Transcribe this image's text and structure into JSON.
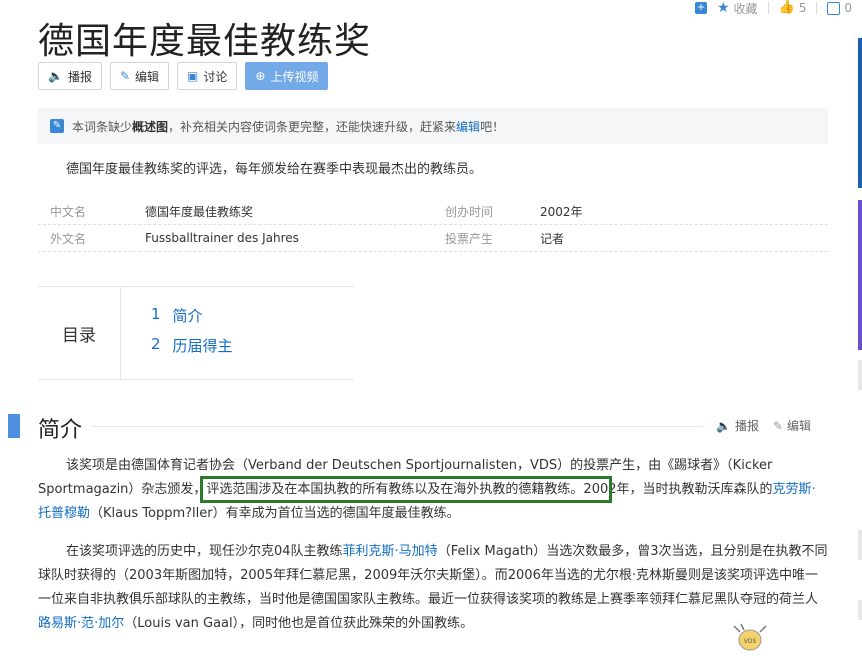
{
  "topbar": {
    "favorite": "收藏",
    "likes": "5",
    "shares": "0"
  },
  "title": "德国年度最佳教练奖",
  "buttons": {
    "read": "播报",
    "edit": "编辑",
    "discuss": "讨论",
    "upload": "上传视频"
  },
  "notice": {
    "pre": "本词条缺少",
    "bold": "概述图",
    "mid": "，补充相关内容使词条更完整，还能快速升级，赶紧来",
    "link": "编辑",
    "post": "吧！"
  },
  "summary": "德国年度最佳教练奖的评选，每年颁发给在赛季中表现最杰出的教练员。",
  "info": [
    {
      "k1": "中文名",
      "v1": "德国年度最佳教练奖",
      "k2": "创办时间",
      "v2": "2002年"
    },
    {
      "k1": "外文名",
      "v1": "Fussballtrainer des Jahres",
      "k2": "投票产生",
      "v2": "记者"
    }
  ],
  "toc": {
    "title": "目录",
    "items": [
      {
        "num": "1",
        "label": "简介"
      },
      {
        "num": "2",
        "label": "历届得主"
      }
    ]
  },
  "section": {
    "title": "简介",
    "read": "播报",
    "edit": "编辑"
  },
  "para1": {
    "a": "该奖项是由德国体育记者协会（Verband der Deutschen Sportjournalisten，VDS）的投票产生，由《踢球者》（Kicker Sportmagazin）杂志颁发，评选范围涉及在本国执教的所有教练以及在海外执教的德籍教练。2002年，当时执教勒沃库森队的",
    "link": "克劳斯·托普穆勒",
    "b": "（Klaus Toppm?ller）有幸成为首位当选的德国年度最佳教练。"
  },
  "para2": {
    "a": "在该奖项评选的历史中，现任沙尔克04队主教练",
    "link1": "菲利克斯·马加特",
    "b": "（Felix Magath）当选次数最多，曾3次当选，且分别是在执教不同球队时获得的（2003年斯图加特，2005年拜仁慕尼黑，2009年沃尔夫斯堡）。而2006年当选的尤尔根·克林斯曼则是该奖项评选中唯一一位来自非执教俱乐部球队的主教练，当时他是德国国家队主教练。最近一位获得该奖项的教练是上赛季率领拜仁慕尼黑队夺冠的荷兰人",
    "link2": "路易斯·范·加尔",
    "c": "（Louis van Gaal），同时他也是首位获此殊荣的外国教练。"
  },
  "mascot_text": "VDS",
  "colors": {
    "accent": "#3a87d6",
    "link": "#136ec2",
    "highlight": "#2b7a2b"
  }
}
